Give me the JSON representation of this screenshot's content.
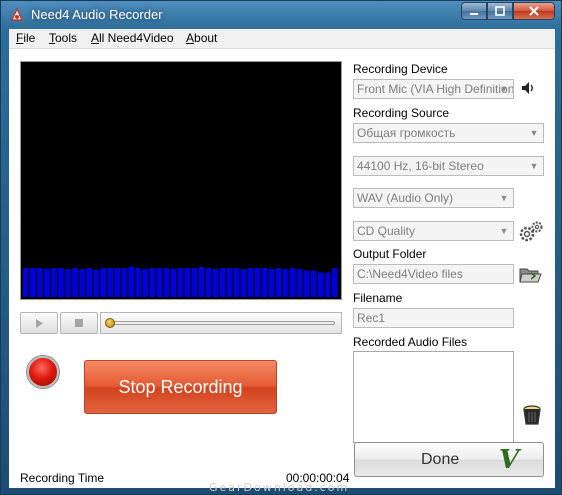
{
  "window": {
    "title": "Need4 Audio Recorder"
  },
  "menu": [
    {
      "label": "File",
      "mnemonic": "F",
      "rest": "ile"
    },
    {
      "label": "Tools",
      "mnemonic": "T",
      "rest": "ools"
    },
    {
      "label": "All Need4Video",
      "mnemonic": "A",
      "rest": "ll Need4Video"
    },
    {
      "label": "About",
      "mnemonic": "A",
      "rest": "bout"
    }
  ],
  "visualizer": {
    "bar_color": "#0000d8",
    "levels": [
      0.85,
      0.85,
      0.85,
      0.82,
      0.85,
      0.85,
      0.82,
      0.85,
      0.82,
      0.85,
      0.8,
      0.85,
      0.85,
      0.85,
      0.85,
      0.9,
      0.85,
      0.82,
      0.85,
      0.85,
      0.85,
      0.82,
      0.85,
      0.85,
      0.85,
      0.88,
      0.85,
      0.82,
      0.85,
      0.85,
      0.85,
      0.82,
      0.85,
      0.85,
      0.85,
      0.82,
      0.85,
      0.82,
      0.85,
      0.82,
      0.78,
      0.78,
      0.72,
      0.72,
      0.85
    ]
  },
  "transport": {
    "play_icon": "play-icon",
    "stop_icon": "stop-icon",
    "seek_position": 0.0
  },
  "record": {
    "stop_label": "Stop Recording"
  },
  "status": {
    "time_label": "Recording Time",
    "time_value": "00:00:00:04"
  },
  "panel": {
    "device_label": "Recording Device",
    "device_value": "Front Mic (VIA High Definition",
    "source_label": "Recording Source",
    "source_value": "Общая громкость",
    "rate_value": "44100 Hz, 16-bit Stereo",
    "format_value": "WAV (Audio Only)",
    "quality_value": "CD Quality",
    "output_label": "Output Folder",
    "output_value": "C:\\Need4Video files",
    "filename_label": "Filename",
    "filename_value": "Rec1",
    "recorded_label": "Recorded Audio Files",
    "recorded_files": []
  },
  "done": {
    "label": "Done",
    "check": "V"
  },
  "watermark": "GearDownload.com",
  "colors": {
    "record": "#e01b10",
    "stop_button": "#e55a34",
    "done_check": "#2f6e1c"
  }
}
